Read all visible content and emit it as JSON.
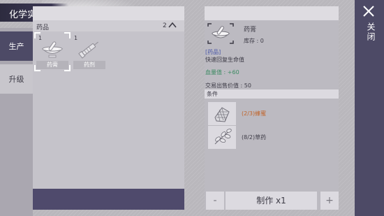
{
  "window": {
    "title": "化学实验台"
  },
  "tabs": [
    {
      "label": "生产",
      "active": true
    },
    {
      "label": "升级",
      "active": false
    }
  ],
  "list": {
    "header_label": "药品",
    "header_count": "2",
    "items": [
      {
        "count": "1",
        "label": "药膏",
        "icon": "mortar-pestle-icon",
        "selected": true
      },
      {
        "count": "1",
        "label": "药剂",
        "icon": "syringe-icon",
        "selected": false
      }
    ]
  },
  "detail": {
    "name": "药膏",
    "stock": "库存 : 0",
    "type": "[药品]",
    "description": "快速回复生命值",
    "stat": "血量值 : +60",
    "sell_price": "交易出售价值 : 50",
    "conditions_label": "条件",
    "conditions": [
      {
        "text": "(2/3)蜂蜜",
        "icon": "honeycomb-icon",
        "satisfied": false
      },
      {
        "text": "(8/2)草药",
        "icon": "herb-icon",
        "satisfied": true
      }
    ]
  },
  "craft": {
    "minus_label": "-",
    "make_label": "制作 x1",
    "plus_label": "+"
  },
  "close": {
    "label": "关闭"
  },
  "colors": {
    "accent_dark": "#4d4a66",
    "panel_light": "#dcdae0",
    "condition_short": "#c1642a",
    "stat_green": "#3c8b62",
    "type_blue": "#4b58a8"
  }
}
